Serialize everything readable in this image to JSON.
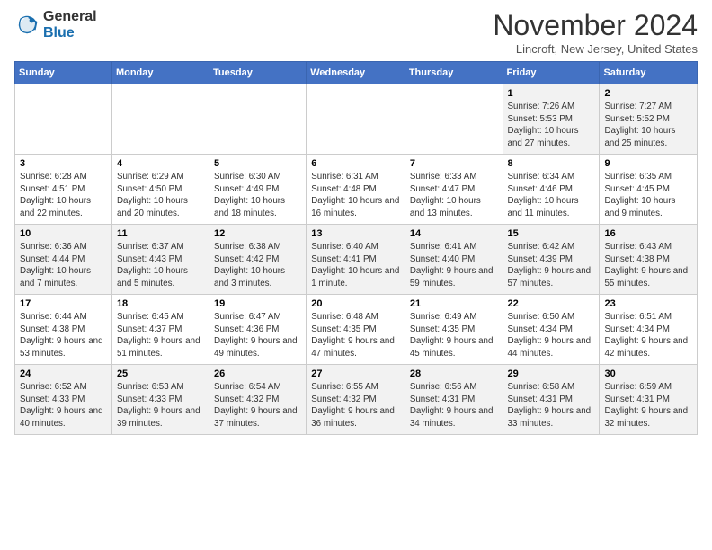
{
  "header": {
    "logo_line1": "General",
    "logo_line2": "Blue",
    "month_title": "November 2024",
    "location": "Lincroft, New Jersey, United States"
  },
  "weekdays": [
    "Sunday",
    "Monday",
    "Tuesday",
    "Wednesday",
    "Thursday",
    "Friday",
    "Saturday"
  ],
  "weeks": [
    [
      {
        "day": "",
        "info": ""
      },
      {
        "day": "",
        "info": ""
      },
      {
        "day": "",
        "info": ""
      },
      {
        "day": "",
        "info": ""
      },
      {
        "day": "",
        "info": ""
      },
      {
        "day": "1",
        "info": "Sunrise: 7:26 AM\nSunset: 5:53 PM\nDaylight: 10 hours and 27 minutes."
      },
      {
        "day": "2",
        "info": "Sunrise: 7:27 AM\nSunset: 5:52 PM\nDaylight: 10 hours and 25 minutes."
      }
    ],
    [
      {
        "day": "3",
        "info": "Sunrise: 6:28 AM\nSunset: 4:51 PM\nDaylight: 10 hours and 22 minutes."
      },
      {
        "day": "4",
        "info": "Sunrise: 6:29 AM\nSunset: 4:50 PM\nDaylight: 10 hours and 20 minutes."
      },
      {
        "day": "5",
        "info": "Sunrise: 6:30 AM\nSunset: 4:49 PM\nDaylight: 10 hours and 18 minutes."
      },
      {
        "day": "6",
        "info": "Sunrise: 6:31 AM\nSunset: 4:48 PM\nDaylight: 10 hours and 16 minutes."
      },
      {
        "day": "7",
        "info": "Sunrise: 6:33 AM\nSunset: 4:47 PM\nDaylight: 10 hours and 13 minutes."
      },
      {
        "day": "8",
        "info": "Sunrise: 6:34 AM\nSunset: 4:46 PM\nDaylight: 10 hours and 11 minutes."
      },
      {
        "day": "9",
        "info": "Sunrise: 6:35 AM\nSunset: 4:45 PM\nDaylight: 10 hours and 9 minutes."
      }
    ],
    [
      {
        "day": "10",
        "info": "Sunrise: 6:36 AM\nSunset: 4:44 PM\nDaylight: 10 hours and 7 minutes."
      },
      {
        "day": "11",
        "info": "Sunrise: 6:37 AM\nSunset: 4:43 PM\nDaylight: 10 hours and 5 minutes."
      },
      {
        "day": "12",
        "info": "Sunrise: 6:38 AM\nSunset: 4:42 PM\nDaylight: 10 hours and 3 minutes."
      },
      {
        "day": "13",
        "info": "Sunrise: 6:40 AM\nSunset: 4:41 PM\nDaylight: 10 hours and 1 minute."
      },
      {
        "day": "14",
        "info": "Sunrise: 6:41 AM\nSunset: 4:40 PM\nDaylight: 9 hours and 59 minutes."
      },
      {
        "day": "15",
        "info": "Sunrise: 6:42 AM\nSunset: 4:39 PM\nDaylight: 9 hours and 57 minutes."
      },
      {
        "day": "16",
        "info": "Sunrise: 6:43 AM\nSunset: 4:38 PM\nDaylight: 9 hours and 55 minutes."
      }
    ],
    [
      {
        "day": "17",
        "info": "Sunrise: 6:44 AM\nSunset: 4:38 PM\nDaylight: 9 hours and 53 minutes."
      },
      {
        "day": "18",
        "info": "Sunrise: 6:45 AM\nSunset: 4:37 PM\nDaylight: 9 hours and 51 minutes."
      },
      {
        "day": "19",
        "info": "Sunrise: 6:47 AM\nSunset: 4:36 PM\nDaylight: 9 hours and 49 minutes."
      },
      {
        "day": "20",
        "info": "Sunrise: 6:48 AM\nSunset: 4:35 PM\nDaylight: 9 hours and 47 minutes."
      },
      {
        "day": "21",
        "info": "Sunrise: 6:49 AM\nSunset: 4:35 PM\nDaylight: 9 hours and 45 minutes."
      },
      {
        "day": "22",
        "info": "Sunrise: 6:50 AM\nSunset: 4:34 PM\nDaylight: 9 hours and 44 minutes."
      },
      {
        "day": "23",
        "info": "Sunrise: 6:51 AM\nSunset: 4:34 PM\nDaylight: 9 hours and 42 minutes."
      }
    ],
    [
      {
        "day": "24",
        "info": "Sunrise: 6:52 AM\nSunset: 4:33 PM\nDaylight: 9 hours and 40 minutes."
      },
      {
        "day": "25",
        "info": "Sunrise: 6:53 AM\nSunset: 4:33 PM\nDaylight: 9 hours and 39 minutes."
      },
      {
        "day": "26",
        "info": "Sunrise: 6:54 AM\nSunset: 4:32 PM\nDaylight: 9 hours and 37 minutes."
      },
      {
        "day": "27",
        "info": "Sunrise: 6:55 AM\nSunset: 4:32 PM\nDaylight: 9 hours and 36 minutes."
      },
      {
        "day": "28",
        "info": "Sunrise: 6:56 AM\nSunset: 4:31 PM\nDaylight: 9 hours and 34 minutes."
      },
      {
        "day": "29",
        "info": "Sunrise: 6:58 AM\nSunset: 4:31 PM\nDaylight: 9 hours and 33 minutes."
      },
      {
        "day": "30",
        "info": "Sunrise: 6:59 AM\nSunset: 4:31 PM\nDaylight: 9 hours and 32 minutes."
      }
    ]
  ]
}
